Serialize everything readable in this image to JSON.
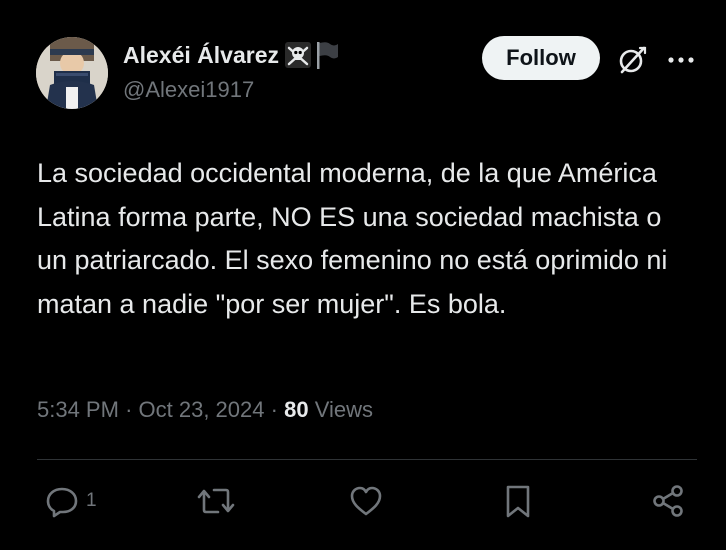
{
  "post": {
    "author": {
      "display_name": "Alexéi Álvarez",
      "name_emojis": [
        "skull-crossbones-icon",
        "black-flag-icon"
      ],
      "handle": "@Alexei1917"
    },
    "follow_label": "Follow",
    "text": "La sociedad occidental moderna, de la que América Latina forma parte, NO ES una sociedad machista o un patriarcado. El sexo femenino no está oprimido ni matan a nadie \"por ser mujer\". Es bola.",
    "time": "5:34 PM",
    "separator": "·",
    "date": "Oct 23, 2024",
    "views_count": "80",
    "views_label": "Views"
  },
  "actions": {
    "reply_count": "1"
  },
  "colors": {
    "background": "#000000",
    "text_primary": "#e7e9ea",
    "text_secondary": "#71767b",
    "divider": "#2f3336",
    "follow_bg": "#eff3f4",
    "follow_text": "#0f1419"
  }
}
